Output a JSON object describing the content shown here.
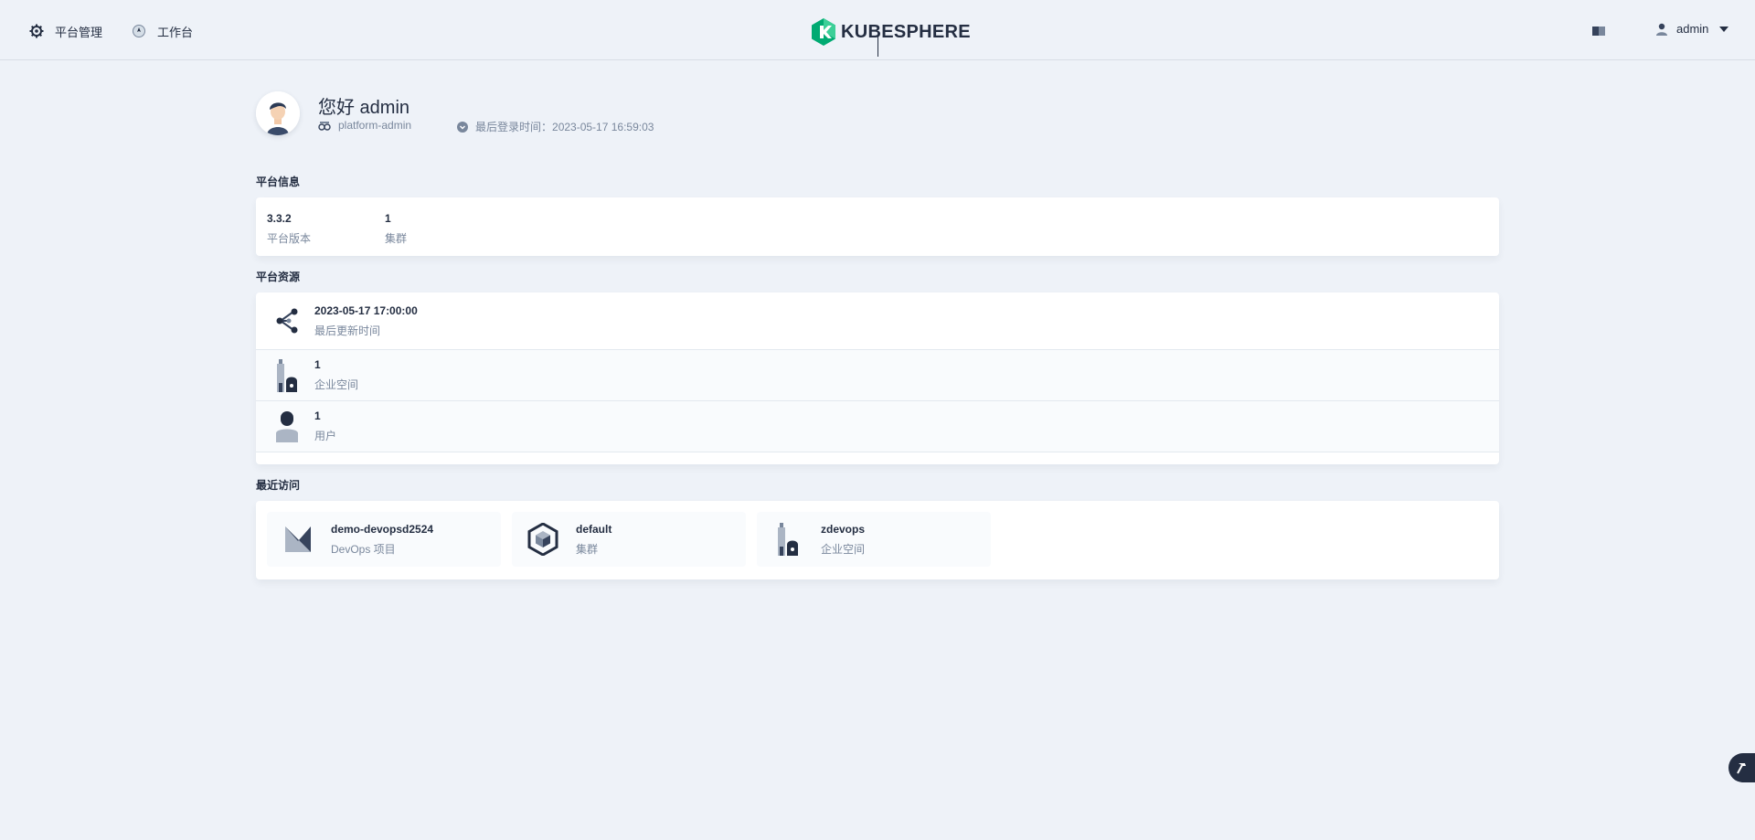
{
  "header": {
    "nav": [
      {
        "label": "平台管理",
        "icon": "gear-icon"
      },
      {
        "label": "工作台",
        "icon": "workbench-icon"
      }
    ],
    "logo_text": "KUBESPHERE",
    "user": {
      "name": "admin",
      "icon": "user-icon"
    },
    "colors": {
      "brand": "#00aa72",
      "text": "#242e42"
    }
  },
  "profile": {
    "greeting": "您好 admin",
    "role": "platform-admin",
    "last_login_label": "最后登录时间：",
    "last_login": "2023-05-17 16:59:03"
  },
  "platform_info": {
    "title": "平台信息",
    "items": [
      {
        "value": "3.3.2",
        "label": "平台版本"
      },
      {
        "value": "1",
        "label": "集群"
      }
    ]
  },
  "platform_resources": {
    "title": "平台资源",
    "items": [
      {
        "value": "2023-05-17 17:00:00",
        "label": "最后更新时间",
        "icon": "share-icon"
      },
      {
        "value": "1",
        "label": "企业空间",
        "icon": "workspace-icon"
      },
      {
        "value": "1",
        "label": "用户",
        "icon": "user-icon"
      }
    ]
  },
  "recent": {
    "title": "最近访问",
    "items": [
      {
        "name": "demo-devopsd2524",
        "type": "DevOps 项目",
        "icon": "devops-project-icon"
      },
      {
        "name": "default",
        "type": "集群",
        "icon": "cluster-icon"
      },
      {
        "name": "zdevops",
        "type": "企业空间",
        "icon": "workspace-icon"
      }
    ]
  },
  "toolbox": {
    "icon": "hammer-icon"
  }
}
